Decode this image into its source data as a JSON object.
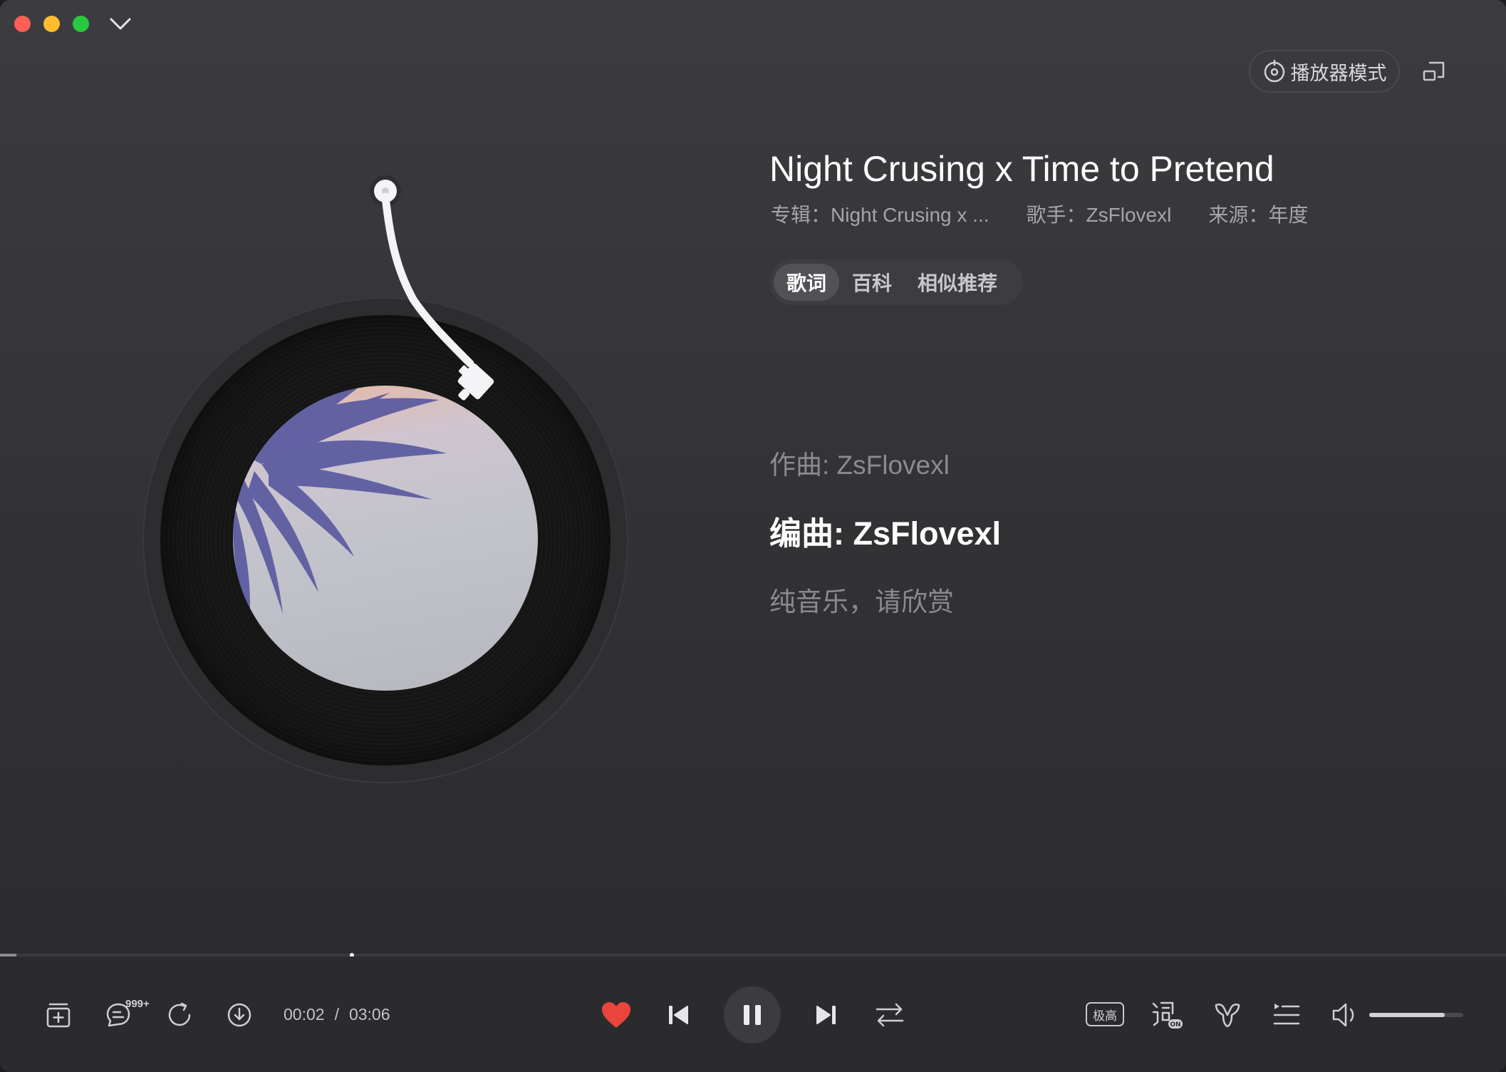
{
  "window": {
    "controls": [
      "close",
      "minimize",
      "maximize"
    ]
  },
  "header": {
    "player_mode_label": "播放器模式",
    "player_mode_icon": "disc-mode-icon",
    "mini_icon": "mini-window-icon"
  },
  "song": {
    "title": "Night Crusing x Time to Pretend",
    "album": "专辑：Night Crusing x ...",
    "artist": "歌手：ZsFlovexl",
    "source": "来源：年度"
  },
  "tabs": [
    {
      "label": "歌词",
      "active": true
    },
    {
      "label": "百科",
      "active": false
    },
    {
      "label": "相似推荐",
      "active": false
    }
  ],
  "lyrics": {
    "composer": "作曲: ZsFlovexl",
    "arranger": "编曲: ZsFlovexl",
    "note": "纯音乐，请欣赏"
  },
  "playback": {
    "progress_fraction": 0.011,
    "current_time": "00:02",
    "separator": "/",
    "total_time": "03:06",
    "comment_count": "999+",
    "liked": true,
    "like_color": "#e8453c",
    "quality_label": "极高",
    "volume_fraction": 0.8
  },
  "icons": {
    "left": [
      "add-to-playlist-icon",
      "comment-icon",
      "share-icon",
      "download-icon"
    ],
    "center": [
      "heart-icon",
      "previous-icon",
      "pause-icon",
      "next-icon",
      "repeat-icon"
    ],
    "right": [
      "quality-icon",
      "lyrics-toggle-icon",
      "sound-effect-icon",
      "playlist-icon",
      "volume-icon"
    ]
  }
}
